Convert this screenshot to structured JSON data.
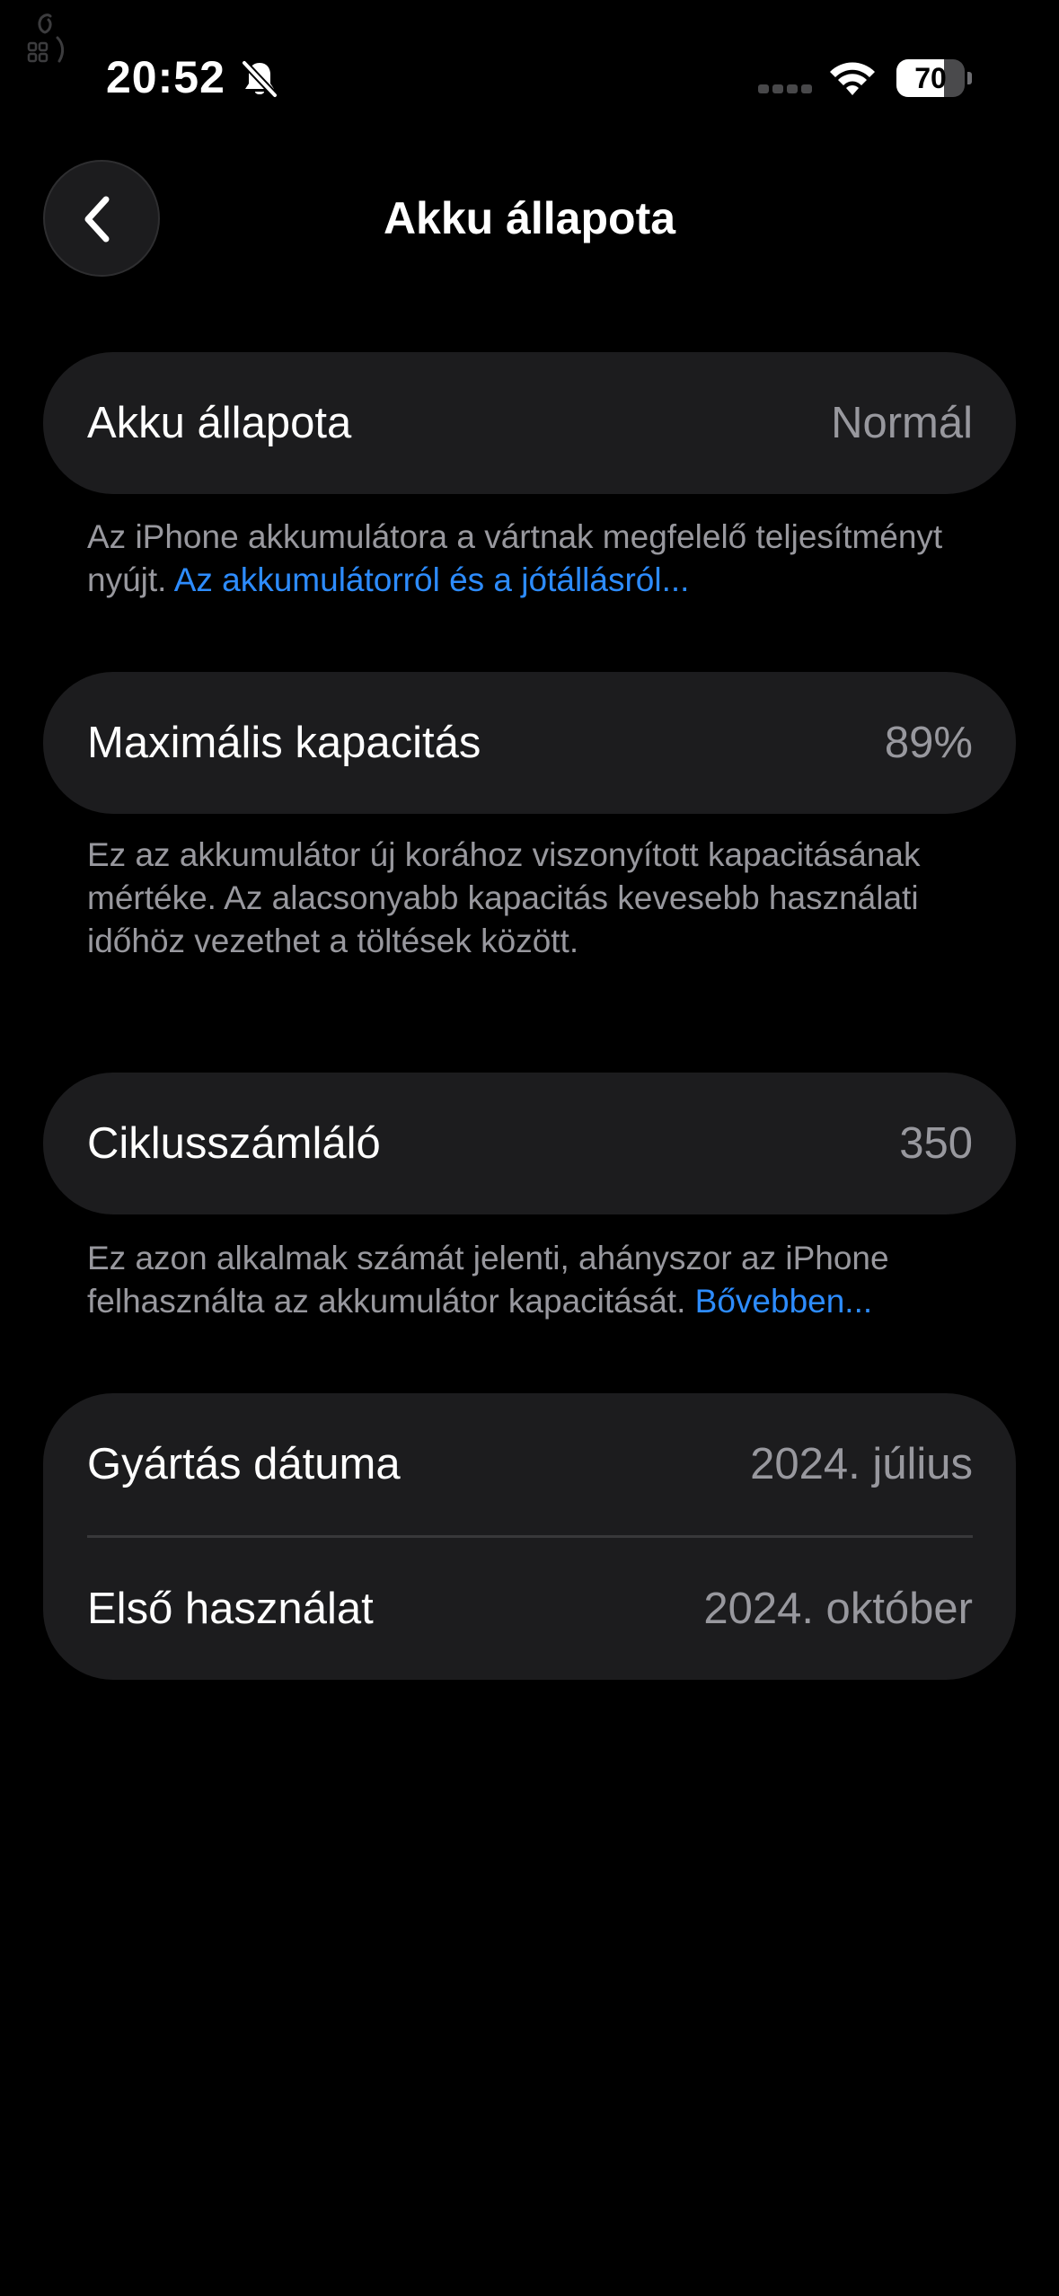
{
  "status_bar": {
    "time": "20:52",
    "battery_level": "70",
    "battery_fraction": 0.7
  },
  "nav": {
    "title": "Akku állapota"
  },
  "battery_health": {
    "label": "Akku állapota",
    "value": "Normál",
    "description": "Az iPhone akkumulátora a vártnak megfelelő teljesítményt nyújt.",
    "link": "Az akkumulátorról és a jótállásról..."
  },
  "max_capacity": {
    "label": "Maximális kapacitás",
    "value": "89%",
    "description": "Ez az akkumulátor új korához viszonyított kapacitásának mértéke. Az alacsonyabb kapacitás kevesebb használati időhöz vezethet a töltések között."
  },
  "cycle_count": {
    "label": "Ciklusszámláló",
    "value": "350",
    "description": "Ez azon alkalmak számát jelenti, ahányszor az iPhone felhasználta az akkumulátor kapacitását.",
    "link": "Bővebben..."
  },
  "dates": {
    "manufacture_label": "Gyártás dátuma",
    "manufacture_value": "2024. július",
    "first_use_label": "Első használat",
    "first_use_value": "2024. október"
  },
  "colors": {
    "background": "#000000",
    "card": "#1c1c1e",
    "secondary_text": "#98989e",
    "link": "#2d8cff"
  },
  "icons": [
    "apple-logo-icon",
    "bell-slash-icon",
    "cellular-signal-icon",
    "wifi-icon",
    "battery-icon",
    "chevron-left-icon"
  ]
}
